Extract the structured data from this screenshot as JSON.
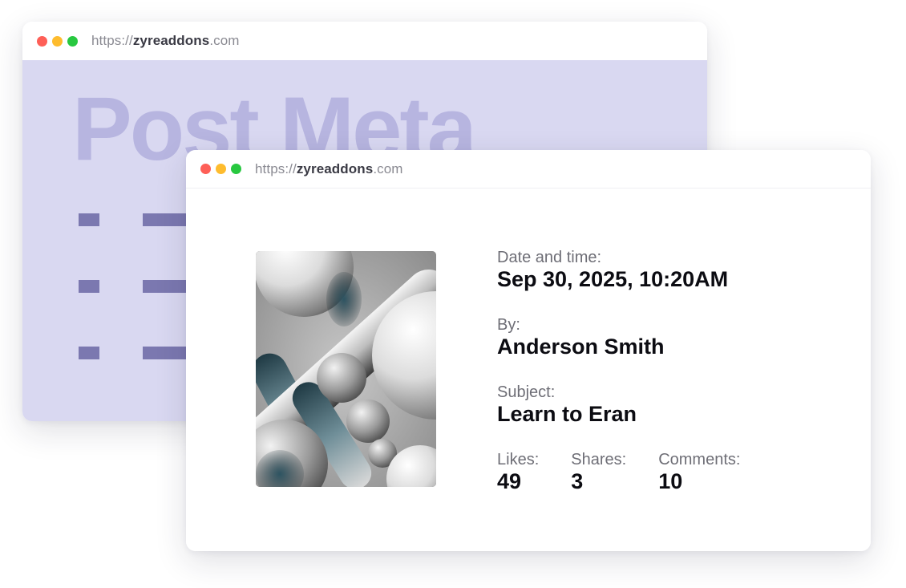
{
  "back_window": {
    "url": {
      "prefix": "https://",
      "domain": "zyreaddons",
      "suffix": ".com"
    },
    "heading": "Post Meta"
  },
  "front_window": {
    "url": {
      "prefix": "https://",
      "domain": "zyreaddons",
      "suffix": ".com"
    },
    "image_alt_icon": "abstract-3d-art-image",
    "date": {
      "label": "Date and time:",
      "value": "Sep 30, 2025, 10:20AM"
    },
    "author": {
      "label": "By:",
      "value": "Anderson Smith"
    },
    "subject": {
      "label": "Subject:",
      "value": "Learn to Eran"
    },
    "stats": [
      {
        "label": "Likes:",
        "value": "49"
      },
      {
        "label": "Shares:",
        "value": "3"
      },
      {
        "label": "Comments:",
        "value": "10"
      }
    ]
  },
  "colors": {
    "dot_close": "#fe5f57",
    "dot_min": "#febc2e",
    "dot_max": "#28c840",
    "back_bg": "#d9d8f1",
    "heading_color": "#b7b5e0",
    "skeleton_color": "#7b78b0"
  }
}
